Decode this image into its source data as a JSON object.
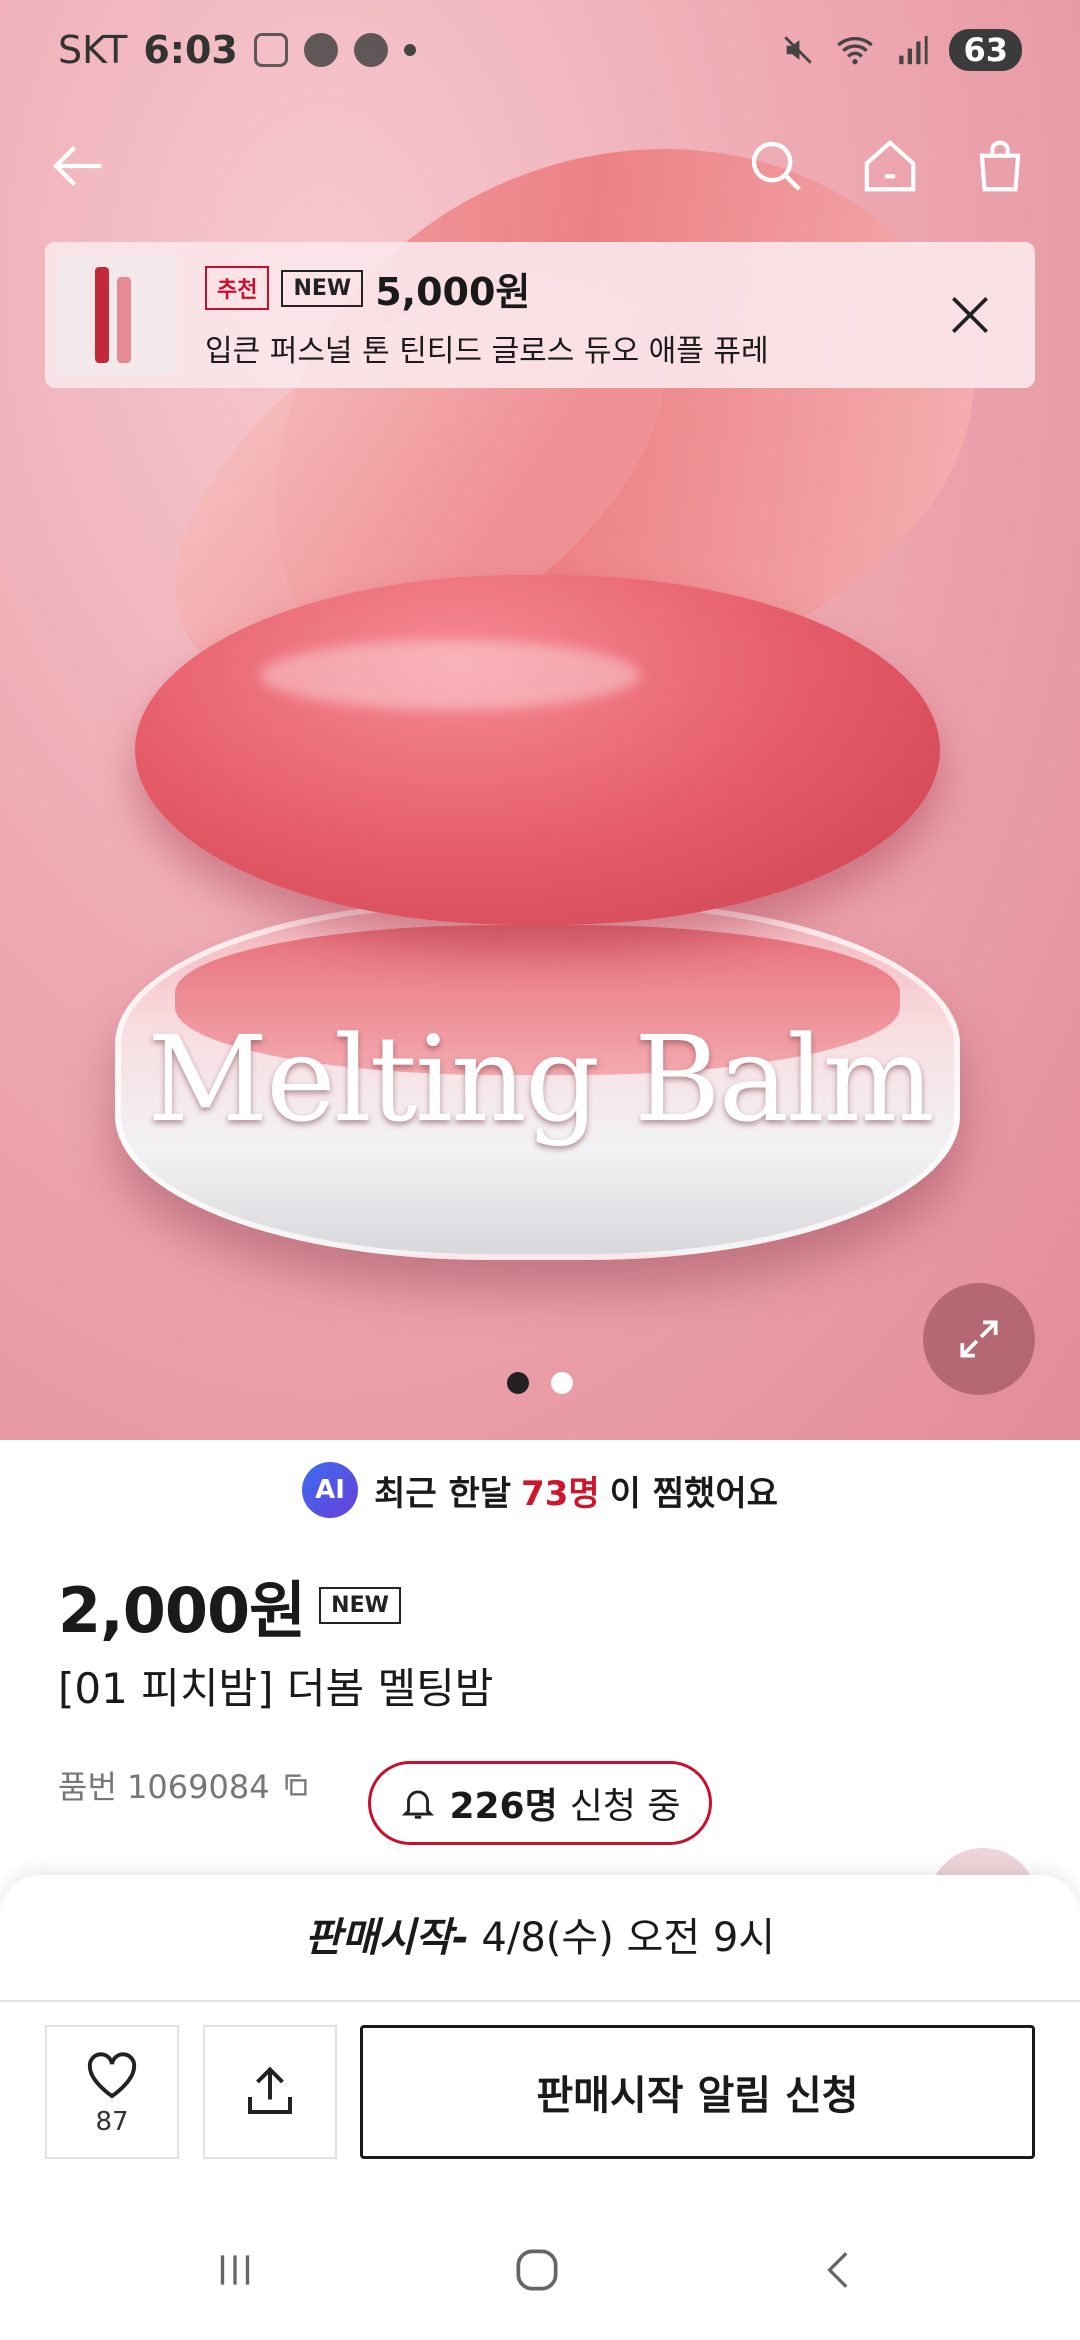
{
  "status_bar": {
    "carrier": "SKT",
    "time": "6:03",
    "battery": "63",
    "left_icons": [
      "screenshot-icon",
      "shield-icon",
      "talk-icon"
    ],
    "right_icons": [
      "mute-icon",
      "wifi-icon",
      "signal-icon"
    ]
  },
  "hero": {
    "product_overlay_text": "Melting Balm",
    "slides_total": 2,
    "slide_active": 1
  },
  "banner": {
    "tag_recommend": "추천",
    "tag_new": "NEW",
    "price": "5,000원",
    "name": "입큰 퍼스널 톤 틴티드 글로스 듀오 애플 퓨레"
  },
  "ai_summary": {
    "badge": "AI",
    "prefix": "최근 한달",
    "count": "73명",
    "suffix": "이 찜했어요"
  },
  "product": {
    "price": "2,000원",
    "tag_new": "NEW",
    "name": "[01 피치밤] 더봄 멜팅밤",
    "sku": "품번 1069084",
    "applied_count": "226명",
    "applied_suffix": "신청 중"
  },
  "bottom_sheet": {
    "sale_label": "판매시작-",
    "sale_date": "4/8(수) 오전 9시",
    "wish_count": "87",
    "notify_label": "판매시작 알림 신청"
  },
  "colors": {
    "accent_red": "#c8102e",
    "ai_gradient": [
      "#3a6df0",
      "#6b3fd8"
    ]
  }
}
